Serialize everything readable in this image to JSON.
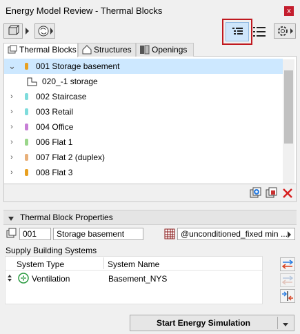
{
  "window": {
    "title": "Energy Model Review - Thermal Blocks",
    "close_glyph": "x"
  },
  "tabs": [
    {
      "label": "Thermal Blocks",
      "active": true
    },
    {
      "label": "Structures",
      "active": false
    },
    {
      "label": "Openings",
      "active": false
    }
  ],
  "tree": {
    "items": [
      {
        "label": "001 Storage basement",
        "color": "#e8a020",
        "expanded": true,
        "selected": true
      },
      {
        "label": "020_-1 storage",
        "child": true
      },
      {
        "label": "002 Staircase",
        "color": "#7fdcdc"
      },
      {
        "label": "003 Retail",
        "color": "#7fdcdc"
      },
      {
        "label": "004 Office",
        "color": "#c77fd6"
      },
      {
        "label": "006 Flat 1",
        "color": "#9ad68a"
      },
      {
        "label": "007 Flat 2 (duplex)",
        "color": "#e8b07a"
      },
      {
        "label": "008 Flat 3",
        "color": "#e8a020"
      }
    ]
  },
  "properties": {
    "header": "Thermal Block Properties",
    "id_value": "001",
    "name_value": "Storage basement",
    "profile_value": "@unconditioned_fixed min ..."
  },
  "systems": {
    "section_label": "Supply Building Systems",
    "columns": [
      "System Type",
      "System Name"
    ],
    "rows": [
      {
        "type": "Ventilation",
        "name": "Basement_NYS"
      }
    ]
  },
  "footer": {
    "start_label": "Start Energy Simulation"
  },
  "colors": {
    "highlight_border": "#c0191f",
    "selection": "#cde8ff",
    "delete_red": "#d62020"
  }
}
